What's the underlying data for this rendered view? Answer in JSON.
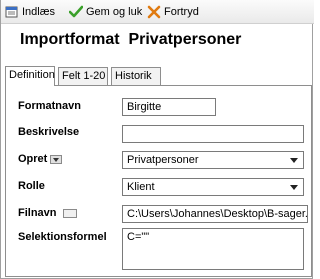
{
  "toolbar": {
    "import_label": "Indlæs",
    "save_close_label": "Gem og luk",
    "cancel_label": "Fortryd"
  },
  "title": "Importformat  Privatpersoner",
  "tabs": [
    {
      "label": "Definition",
      "active": true
    },
    {
      "label": "Felt 1-20",
      "active": false
    },
    {
      "label": "Historik",
      "active": false
    }
  ],
  "form": {
    "formatnavn": {
      "label": "Formatnavn",
      "value": "Birgitte"
    },
    "beskrivelse": {
      "label": "Beskrivelse",
      "value": ""
    },
    "opret": {
      "label": "Opret",
      "value": "Privatpersoner"
    },
    "rolle": {
      "label": "Rolle",
      "value": "Klient"
    },
    "filnavn": {
      "label": "Filnavn",
      "value": "C:\\Users\\Johannes\\Desktop\\B-sager.xls"
    },
    "selektionsformel": {
      "label": "Selektionsformel",
      "value": "C=\"\""
    }
  },
  "colors": {
    "save_icon": "#3aa02a",
    "cancel_icon": "#e07a10"
  }
}
